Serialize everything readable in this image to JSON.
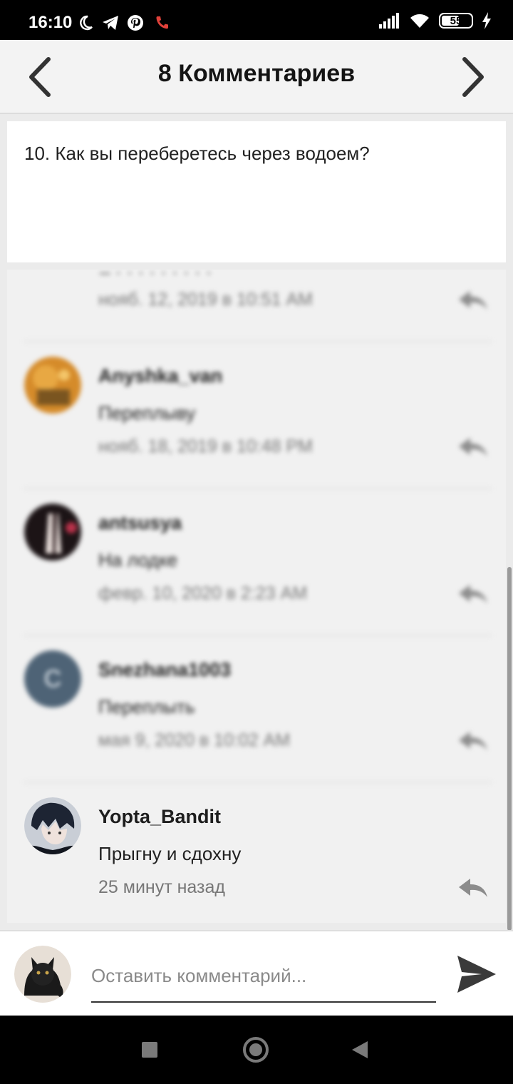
{
  "status_bar": {
    "time": "16:10",
    "battery": "55",
    "icons": [
      "moon-icon",
      "telegram-icon",
      "pinterest-icon",
      "missed-call-icon",
      "signal-icon",
      "wifi-icon",
      "battery-icon",
      "charging-icon"
    ]
  },
  "header": {
    "title": "8 Комментариев",
    "prev_icon": "chevron-left-icon",
    "next_icon": "chevron-right-icon"
  },
  "question": {
    "text": "10. Как вы переберетесь через водоем?"
  },
  "comments": [
    {
      "author": "",
      "text": "",
      "time": "нояб. 12, 2019 в 10:51 AM"
    },
    {
      "author": "Anyshka_van",
      "text": "Переплыву",
      "time": "нояб. 18, 2019 в 10:48 PM"
    },
    {
      "author": "antsusya",
      "text": "На лодке",
      "time": "февр. 10, 2020 в 2:23 AM"
    },
    {
      "author": "Snezhana1003",
      "text": "Переплыть",
      "time": "мая 9, 2020 в 10:02 AM",
      "avatar_letter": "C"
    },
    {
      "author": "Yopta_Bandit",
      "text": "Прыгну и сдохну",
      "time": "25 минут назад"
    }
  ],
  "input": {
    "placeholder": "Оставить комментарий..."
  },
  "colors": {
    "accent_dark": "#1e1e1e",
    "muted_text": "#777777",
    "reply_icon": "#8c8c8c",
    "send_icon": "#3a3a3a",
    "avatar_c_bg": "#4e6376"
  }
}
